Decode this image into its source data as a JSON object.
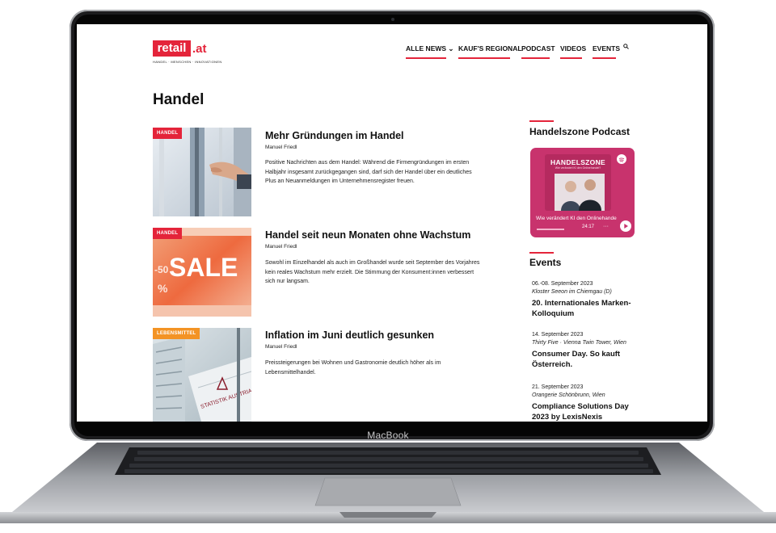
{
  "device": {
    "brand_label": "MacBook"
  },
  "site": {
    "logo_text": "retail",
    "logo_tld": ".at",
    "logo_tagline": "HANDEL · MENSCHEN · INNOVATIONEN"
  },
  "nav": {
    "items": [
      {
        "label": "ALLE NEWS ⌄"
      },
      {
        "label": "KAUF'S REGIONAL"
      },
      {
        "label": "PODCAST"
      },
      {
        "label": "VIDEOS"
      },
      {
        "label": "EVENTS"
      }
    ],
    "search_icon": "search-icon"
  },
  "page": {
    "title": "Handel"
  },
  "articles": [
    {
      "category": "HANDEL",
      "title": "Mehr Gründungen im Handel",
      "author": "Manuel Friedl",
      "teaser": "Positive Nachrichten aus dem Handel: Während die Firmengründungen im ersten Halbjahr insgesamt zurückgegangen sind, darf sich der Handel über ein deutliches Plus an Neuanmeldungen im Unternehmensregister freuen."
    },
    {
      "category": "HANDEL",
      "title": "Handel seit neun Monaten ohne Wachstum",
      "author": "Manuel Friedl",
      "teaser": "Sowohl im Einzelhandel als auch im Großhandel wurde seit September des Vorjahres kein reales Wachstum mehr erzielt. Die Stimmung der Konsument:innen verbessert sich nur langsam.",
      "image_text": "SALE",
      "image_text_2": "-50",
      "image_text_3": "%"
    },
    {
      "category": "LEBENSMITTEL",
      "title": "Inflation im Juni deutlich gesunken",
      "author": "Manuel Friedl",
      "teaser": "Preissteigerungen bei Wohnen und Gastronomie deutlich höher als im Lebensmittelhandel.",
      "image_text": "STATISTIK AUSTRIA"
    }
  ],
  "sidebar": {
    "podcast": {
      "heading": "Handelszone Podcast",
      "cover_title": "HANDELSZONE",
      "cover_subtitle": "Wie verändert KI den Onlinehandel?",
      "episode_title": "Wie verändert KI den Onlinehandel?",
      "duration": "24:17",
      "more": "···",
      "accent": "#c8336d"
    },
    "events_heading": "Events",
    "events": [
      {
        "date": "06.-08. September 2023",
        "location": "Kloster Seeon im Chiemgau (D)",
        "title": "20. Internationales Marken-Kolloquium"
      },
      {
        "date": "14. September 2023",
        "location": "Thirty Five · Vienna Twin Tower, Wien",
        "title": "Consumer Day. So kauft Österreich."
      },
      {
        "date": "21. September 2023",
        "location": "Orangerie Schönbrunn, Wien",
        "title": "Compliance Solutions Day 2023 by LexisNexis"
      }
    ]
  },
  "colors": {
    "brand": "#e4243a",
    "category_orange": "#f39324",
    "podcast": "#c8336d"
  }
}
